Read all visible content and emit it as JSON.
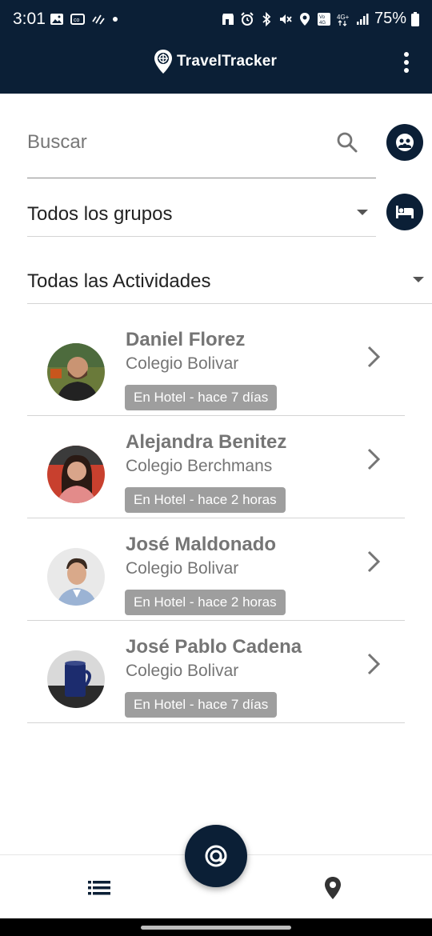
{
  "status_bar": {
    "time": "3:01",
    "battery_percent": "75%",
    "left_icons": [
      "image-icon",
      "cast-icon",
      "vibrate-icon",
      "dot-icon"
    ],
    "right_icons": [
      "store-icon",
      "alarm-icon",
      "bluetooth-icon",
      "mute-icon",
      "location-icon",
      "volte-icon",
      "4g-icon",
      "signal-icon",
      "battery-icon"
    ]
  },
  "app_bar": {
    "title": "TravelTracker",
    "menu_icon": "more-vert-icon"
  },
  "search": {
    "placeholder": "Buscar",
    "value": ""
  },
  "filters": {
    "group_selected": "Todos los grupos",
    "activity_selected": "Todas las Actividades"
  },
  "people": [
    {
      "name": "Daniel Florez",
      "school": "Colegio Bolivar",
      "status": "En Hotel - hace 7 días"
    },
    {
      "name": "Alejandra Benitez",
      "school": "Colegio Berchmans",
      "status": "En Hotel - hace 2 horas"
    },
    {
      "name": "José Maldonado",
      "school": "Colegio Bolivar",
      "status": "En Hotel - hace 2 horas"
    },
    {
      "name": "José Pablo Cadena",
      "school": "Colegio Bolivar",
      "status": "En Hotel - hace 7 días"
    }
  ],
  "bottom_nav": {
    "items": [
      "list-icon",
      "map-pin-icon"
    ],
    "fab_icon": "at-target-icon"
  },
  "colors": {
    "primary": "#0b1f36",
    "text_gray": "#757575",
    "badge_gray": "#9e9e9e",
    "divider": "#d4d4d4"
  }
}
